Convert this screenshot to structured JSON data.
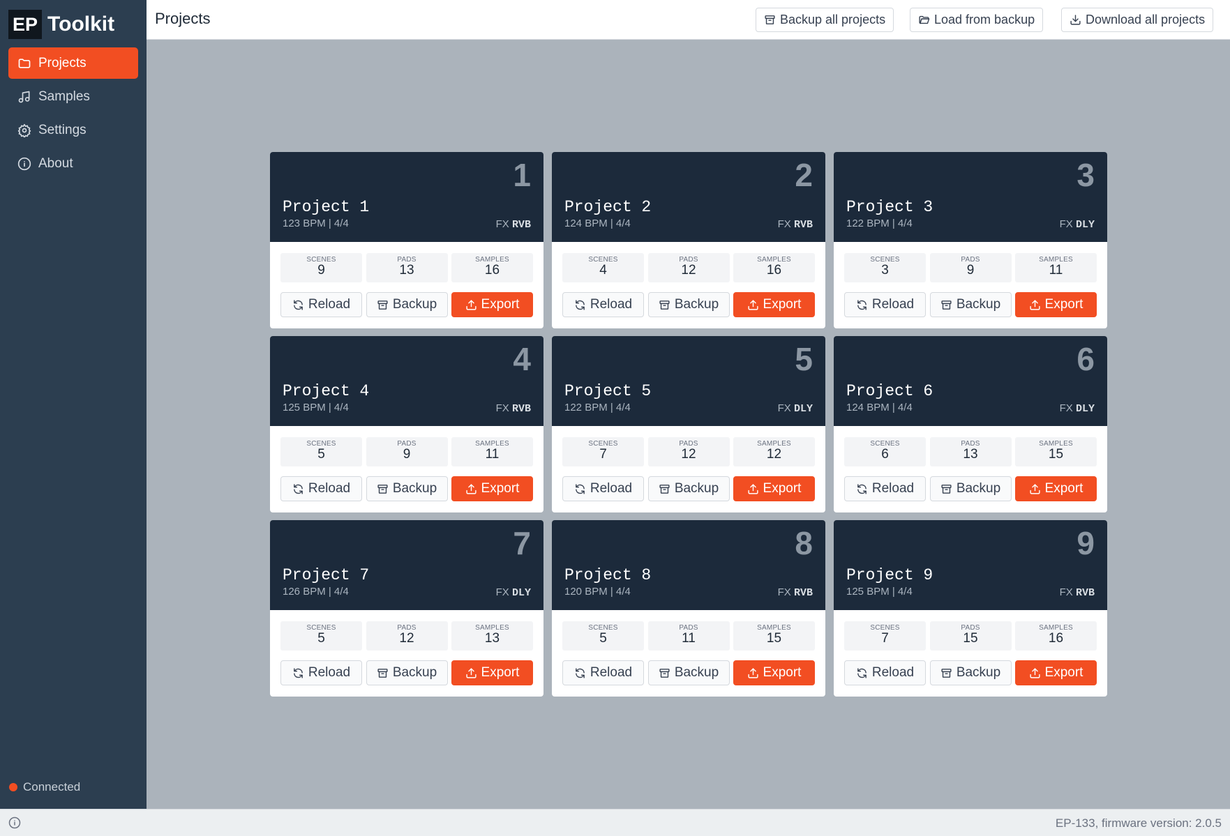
{
  "sidebar": {
    "logo_box": "EP",
    "logo_text": "Toolkit",
    "items": [
      {
        "label": "Projects",
        "icon": "folder-icon",
        "active": true
      },
      {
        "label": "Samples",
        "icon": "music-note-icon",
        "active": false
      },
      {
        "label": "Settings",
        "icon": "gear-icon",
        "active": false
      },
      {
        "label": "About",
        "icon": "info-icon",
        "active": false
      }
    ],
    "status": "Connected",
    "status_color": "#f24e22"
  },
  "header": {
    "title": "Projects",
    "backup_all": "Backup all projects",
    "load_backup": "Load from backup",
    "download_all": "Download all projects"
  },
  "footer": {
    "device": "EP-133, firmware version: 2.0.5"
  },
  "card_labels": {
    "scenes": "SCENES",
    "pads": "PADS",
    "samples": "SAMPLES",
    "reload": "Reload",
    "backup": "Backup",
    "export": "Export",
    "fx": "FX"
  },
  "projects": [
    {
      "num": "1",
      "name": "Project 1",
      "meta": "123 BPM | 4/4",
      "fx": "RVB",
      "scenes": "9",
      "pads": "13",
      "samples": "16"
    },
    {
      "num": "2",
      "name": "Project 2",
      "meta": "124 BPM | 4/4",
      "fx": "RVB",
      "scenes": "4",
      "pads": "12",
      "samples": "16"
    },
    {
      "num": "3",
      "name": "Project 3",
      "meta": "122 BPM | 4/4",
      "fx": "DLY",
      "scenes": "3",
      "pads": "9",
      "samples": "11"
    },
    {
      "num": "4",
      "name": "Project 4",
      "meta": "125 BPM | 4/4",
      "fx": "RVB",
      "scenes": "5",
      "pads": "9",
      "samples": "11"
    },
    {
      "num": "5",
      "name": "Project 5",
      "meta": "122 BPM | 4/4",
      "fx": "DLY",
      "scenes": "7",
      "pads": "12",
      "samples": "12"
    },
    {
      "num": "6",
      "name": "Project 6",
      "meta": "124 BPM | 4/4",
      "fx": "DLY",
      "scenes": "6",
      "pads": "13",
      "samples": "15"
    },
    {
      "num": "7",
      "name": "Project 7",
      "meta": "126 BPM | 4/4",
      "fx": "DLY",
      "scenes": "5",
      "pads": "12",
      "samples": "13"
    },
    {
      "num": "8",
      "name": "Project 8",
      "meta": "120 BPM | 4/4",
      "fx": "RVB",
      "scenes": "5",
      "pads": "11",
      "samples": "15"
    },
    {
      "num": "9",
      "name": "Project 9",
      "meta": "125 BPM | 4/4",
      "fx": "RVB",
      "scenes": "7",
      "pads": "15",
      "samples": "16"
    }
  ],
  "colors": {
    "accent": "#f24e22",
    "sidebar": "#2c3e50",
    "card_header": "#1c2a3b",
    "background": "#abb3bb"
  }
}
